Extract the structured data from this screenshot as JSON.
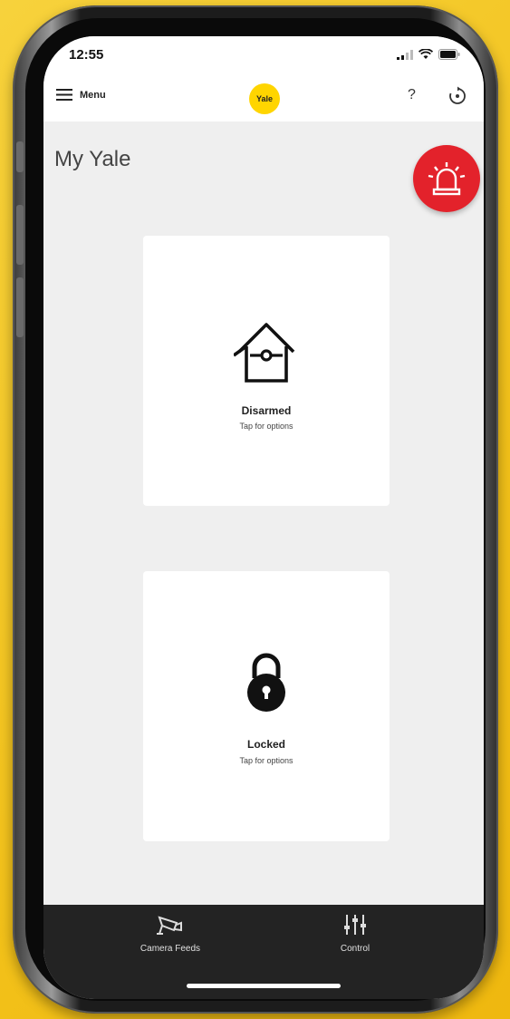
{
  "status_bar": {
    "time": "12:55"
  },
  "header": {
    "menu_label": "Menu",
    "logo_text": "Yale",
    "help_label": "?"
  },
  "page": {
    "title": "My Yale"
  },
  "cards": [
    {
      "status": "Disarmed",
      "hint": "Tap for options",
      "icon": "house-alarm-icon"
    },
    {
      "status": "Locked",
      "hint": "Tap for options",
      "icon": "padlock-icon"
    }
  ],
  "tabbar": {
    "items": [
      {
        "label": "Camera Feeds",
        "icon": "camera-icon"
      },
      {
        "label": "Control",
        "icon": "sliders-icon"
      }
    ]
  },
  "colors": {
    "brand_yellow": "#ffd500",
    "alarm_red": "#e3222b",
    "tabbar_bg": "#232323",
    "screen_bg": "#efefef"
  }
}
